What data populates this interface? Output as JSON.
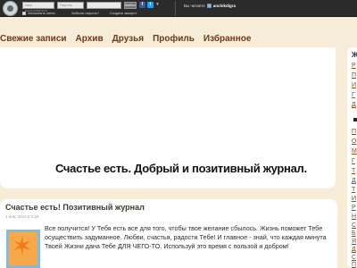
{
  "topbar": {
    "login_placeholder": "Имя пользователя",
    "password_placeholder": "Пароль",
    "login_button": "Войти",
    "remember_label": "Запомнить меня",
    "forgot_label": "Забыли пароль?",
    "create_label": "Создать аккаунт",
    "you_are_label": "Вы читаете",
    "username": "anchikdigra",
    "social": [
      "f",
      "t"
    ]
  },
  "nav": {
    "items": [
      "Свежие записи",
      "Архив",
      "Друзья",
      "Профиль",
      "Избранное"
    ]
  },
  "banner": {
    "title": "Счастье есть. Добрый и позитивный журнал."
  },
  "post": {
    "title": "Счастье есть! Позитивный журнал",
    "date": "1 янв, 2010 в 0:20",
    "text": "Все получится! У Тебя есть все для того, чтобы твое желание сбылось. Жизнь поможет Тебе осуществить задуманное. Любви, счастья, радости Тебе! И главное - знай, что каждая минута Твоей Жизни дана Тебе ДЛЯ ЧЕГО-ТО. Используй это время с пользой и добром!"
  },
  "sidebar": {
    "heading": "Ж",
    "links": [
      "Р",
      "П",
      "И",
      "Г",
      "Д",
      "П",
      "О",
      "М",
      "Г",
      "Т",
      "Д",
      "Т",
      "И",
      "Р",
      "Н",
      "С",
      "Б",
      "Я",
      "Д",
      "С",
      "П"
    ]
  },
  "colors": {
    "topbar": "#2b2b2b",
    "page_bg": "#f6ecd7",
    "nav_link": "#6b3a1a",
    "sidebar_link": "#8a4a1a"
  }
}
